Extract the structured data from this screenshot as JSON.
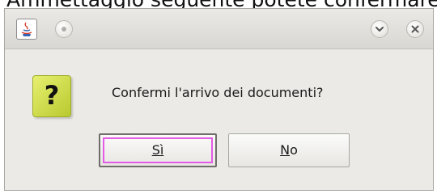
{
  "background_caption": "Ammettaggio seguente potete confermare",
  "window": {
    "app_icon": "java-cup-icon",
    "titlebar_buttons": [
      {
        "name": "minimize-circle",
        "icon": "circle-icon"
      },
      {
        "name": "dropdown",
        "icon": "chevron-down-icon"
      },
      {
        "name": "close",
        "icon": "close-icon"
      }
    ]
  },
  "dialog": {
    "icon": "question-mark-icon",
    "icon_glyph": "?",
    "icon_color": "#d3df4d",
    "message": "Confermi l'arrivo dei documenti?",
    "buttons": {
      "yes_label": "Sì",
      "no_label_mnemonic": "N",
      "no_label_rest": "o"
    },
    "focus_color": "#e45be6"
  }
}
